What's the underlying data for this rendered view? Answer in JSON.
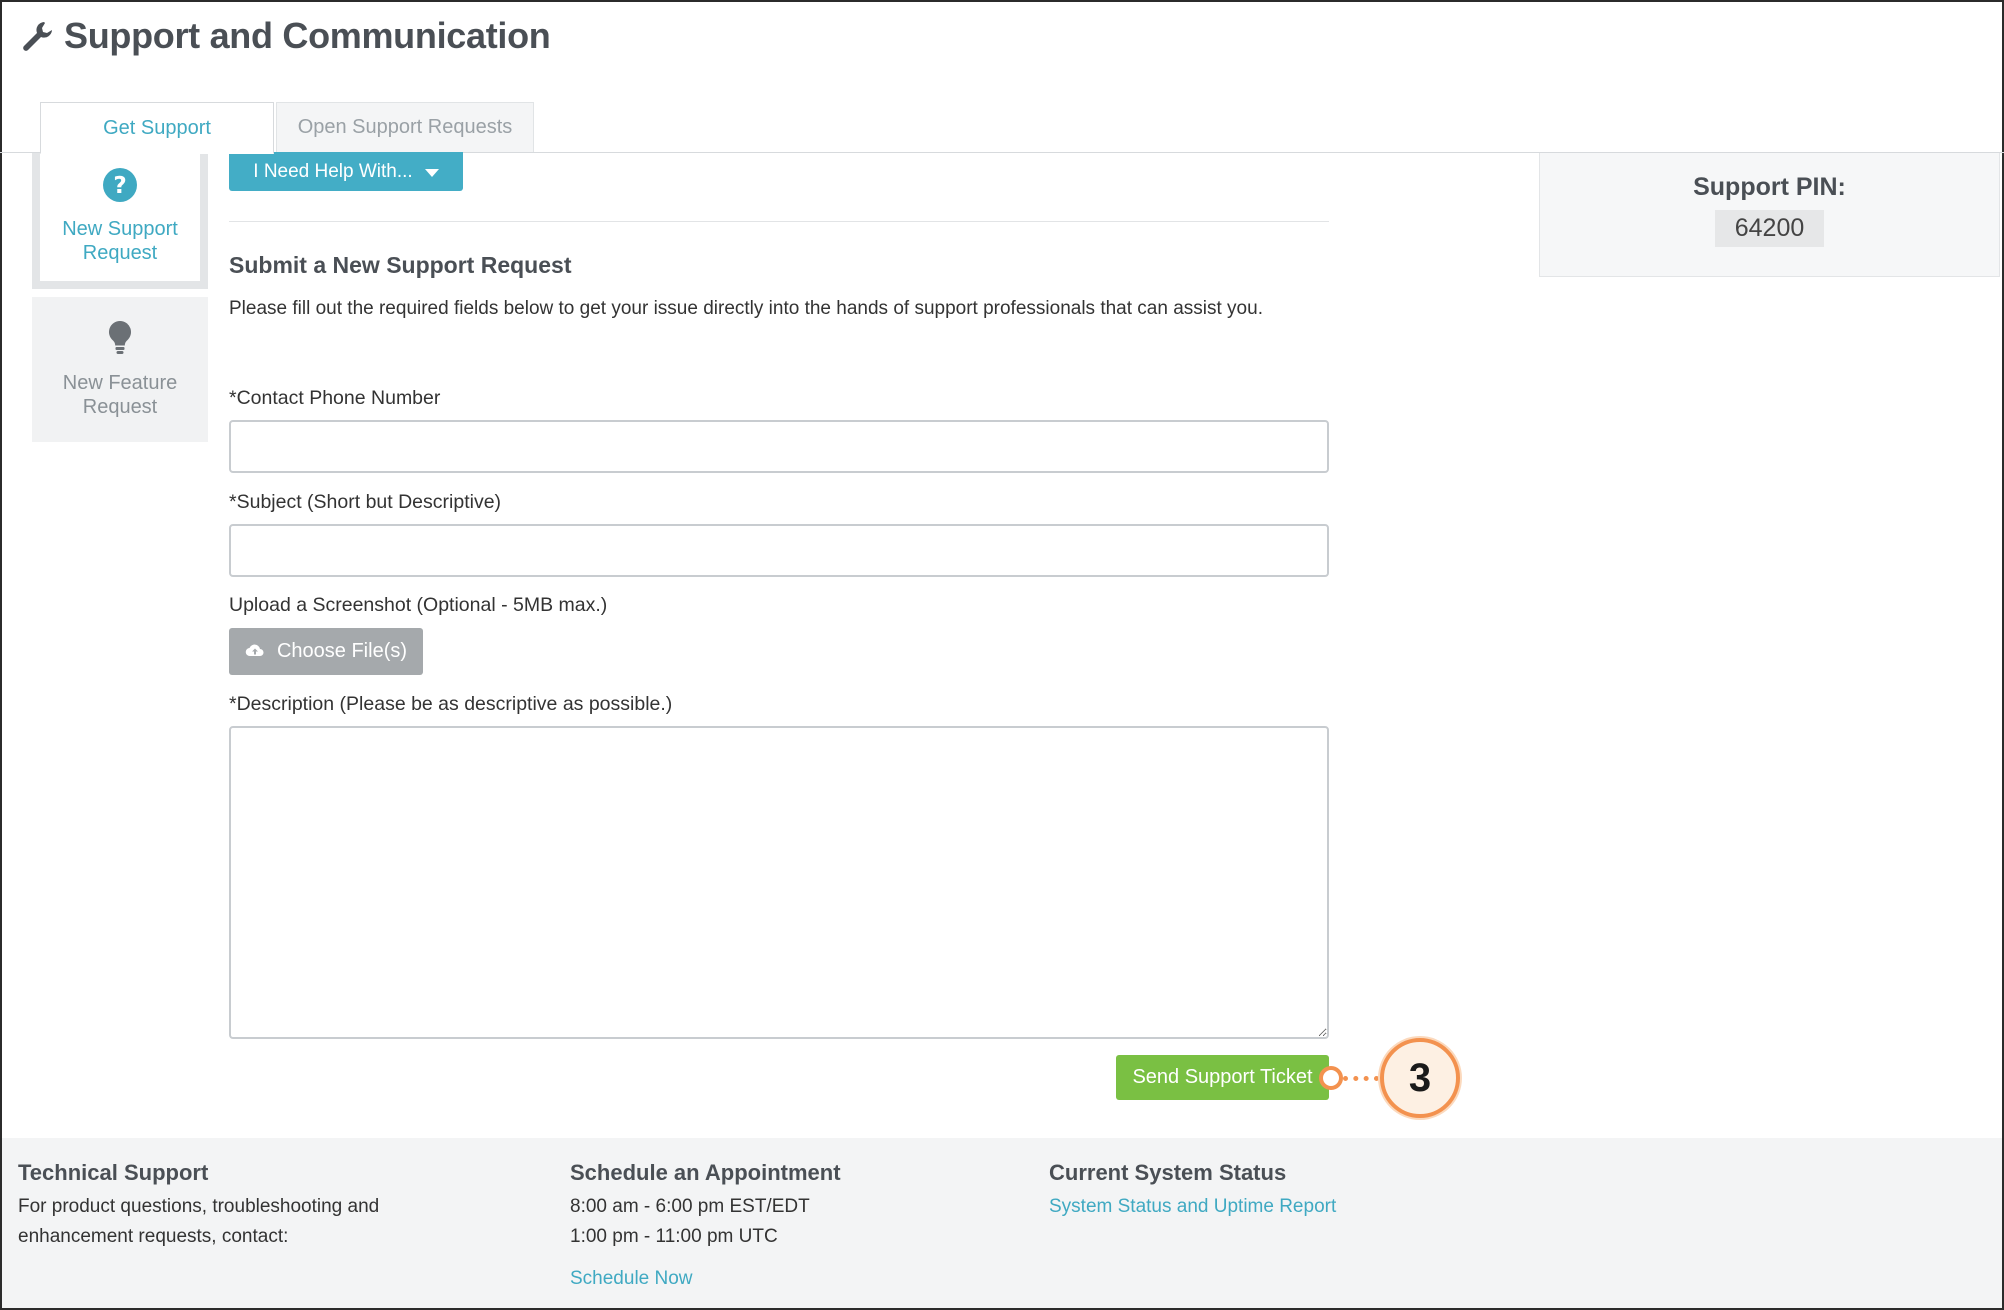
{
  "page": {
    "title": "Support and Communication"
  },
  "tabs": [
    {
      "label": "Get Support",
      "active": true
    },
    {
      "label": "Open Support Requests",
      "active": false
    }
  ],
  "sidebar": {
    "items": [
      {
        "label_line1": "New Support",
        "label_line2": "Request",
        "icon": "question-circle-icon",
        "active": true
      },
      {
        "label_line1": "New Feature",
        "label_line2": "Request",
        "icon": "lightbulb-icon",
        "active": false
      }
    ]
  },
  "help_dropdown": {
    "label": "I Need Help With..."
  },
  "form": {
    "title": "Submit a New Support Request",
    "description": "Please fill out the required fields below to get your issue directly into the hands of support professionals that can assist you.",
    "phone_label": "*Contact Phone Number",
    "phone_value": "",
    "subject_label": "*Subject (Short but Descriptive)",
    "subject_value": "",
    "upload_label": "Upload a Screenshot (Optional - 5MB max.)",
    "upload_button": "Choose File(s)",
    "description_label": "*Description (Please be as descriptive as possible.)",
    "description_value": "",
    "submit_button": "Send Support Ticket"
  },
  "callout": {
    "number": "3"
  },
  "support_pin": {
    "label": "Support PIN:",
    "value": "64200"
  },
  "footer": {
    "technical_support": {
      "heading": "Technical Support",
      "line1": "For product questions, troubleshooting and",
      "line2": "enhancement requests, contact:"
    },
    "appointment": {
      "heading": "Schedule an Appointment",
      "hours1": "8:00 am - 6:00 pm EST/EDT",
      "hours2": "1:00 pm - 11:00 pm UTC",
      "link": "Schedule Now"
    },
    "system_status": {
      "heading": "Current System Status",
      "link": "System Status and Uptime Report"
    }
  },
  "colors": {
    "accent": "#43adc6",
    "submit": "#7ac043",
    "callout": "#f3924f"
  }
}
